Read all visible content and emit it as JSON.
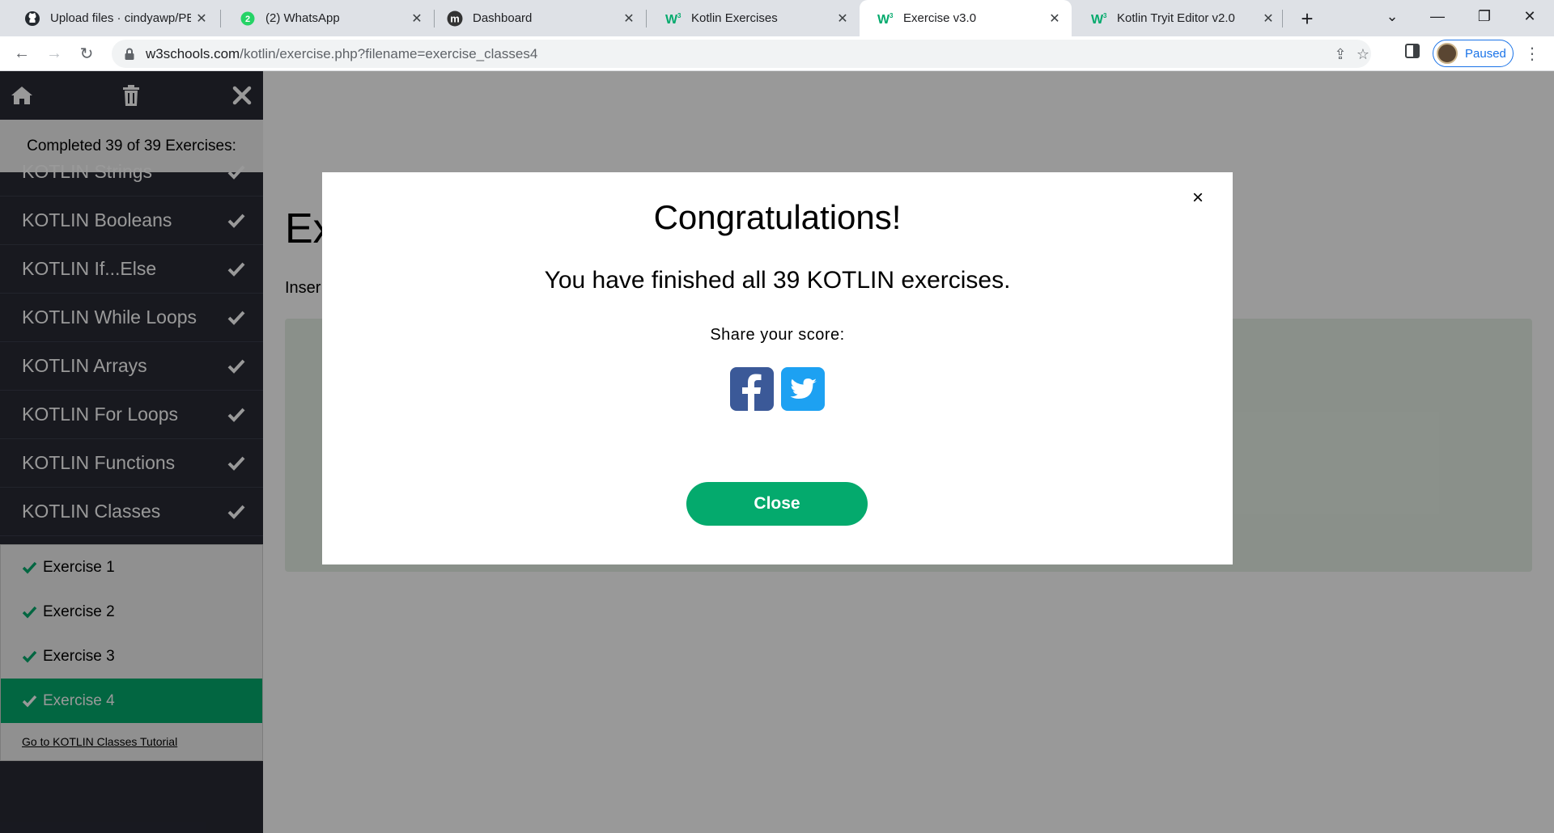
{
  "browser": {
    "tabs": [
      {
        "title": "Upload files · cindyawp/PBC",
        "icon": "github-icon",
        "active": false
      },
      {
        "title": "(2) WhatsApp",
        "icon": "whatsapp-icon",
        "badge": "2",
        "active": false
      },
      {
        "title": "Dashboard",
        "icon": "moodle-icon",
        "active": false
      },
      {
        "title": "Kotlin Exercises",
        "icon": "w3schools-icon",
        "active": false
      },
      {
        "title": "Exercise v3.0",
        "icon": "w3schools-icon",
        "active": true
      },
      {
        "title": "Kotlin Tryit Editor v2.0",
        "icon": "w3schools-icon",
        "active": false
      }
    ],
    "new_tab_icon": "plus-icon",
    "address": {
      "host": "w3schools.com",
      "path": "/kotlin/exercise.php?filename=exercise_classes4"
    },
    "profile": {
      "status": "Paused"
    }
  },
  "sidebar": {
    "progress_text": "Completed 39 of 39 Exercises:",
    "chapters": [
      {
        "label": "KOTLIN Strings",
        "completed": true
      },
      {
        "label": "KOTLIN Booleans",
        "completed": true
      },
      {
        "label": "KOTLIN If...Else",
        "completed": true
      },
      {
        "label": "KOTLIN While Loops",
        "completed": true
      },
      {
        "label": "KOTLIN Arrays",
        "completed": true
      },
      {
        "label": "KOTLIN For Loops",
        "completed": true
      },
      {
        "label": "KOTLIN Functions",
        "completed": true
      },
      {
        "label": "KOTLIN Classes",
        "completed": true
      }
    ],
    "exercises": [
      {
        "label": "Exercise 1",
        "completed": true,
        "active": false
      },
      {
        "label": "Exercise 2",
        "completed": true,
        "active": false
      },
      {
        "label": "Exercise 3",
        "completed": true,
        "active": false
      },
      {
        "label": "Exercise 4",
        "completed": true,
        "active": true
      }
    ],
    "tutorial_link": "Go to KOTLIN Classes Tutorial"
  },
  "main": {
    "title_visible": "Ex",
    "instruction_visible": "Inser"
  },
  "modal": {
    "heading": "Congratulations!",
    "message": "You have finished all 39 KOTLIN exercises.",
    "share_label": "Share your score:",
    "close_label": "Close",
    "close_x": "×"
  },
  "colors": {
    "w3_green": "#04aa6d",
    "sidebar_dark": "#282a35",
    "facebook": "#3b5998",
    "twitter": "#1da1f2"
  }
}
